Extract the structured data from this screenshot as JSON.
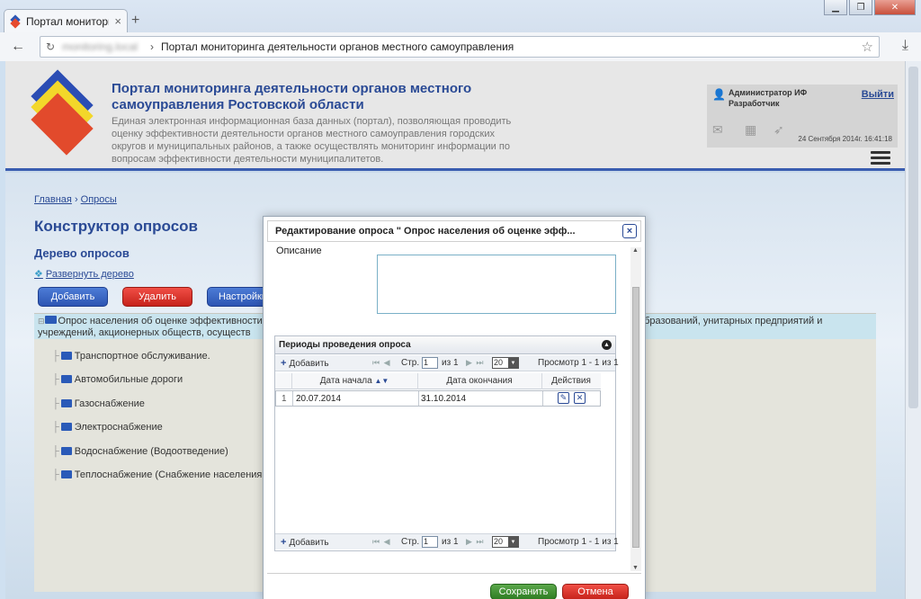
{
  "browser": {
    "tab_title": "Портал мониторинга",
    "tab_close": "×",
    "new_tab": "+",
    "url_host": "monitoring.local",
    "url_separator": "›",
    "page_title": "Портал мониторинга деятельности органов местного самоуправления"
  },
  "header": {
    "title": "Портал мониторинга деятельности органов местного самоуправления Ростовской области",
    "description": "Единая электронная информационная база данных (портал), позволяющая проводить оценку эффективности деятельности органов местного самоуправления городских округов и муниципальных районов, а также осуществлять мониторинг информации по вопросам эффективности деятельности муниципалитетов.",
    "user_name": "Администратор ИФ",
    "user_role": "Разработчик",
    "logout": "Выйти",
    "datetime": "24 Сентября 2014г. 16:41:18"
  },
  "breadcrumb": {
    "home": "Главная",
    "sep": "›",
    "current": "Опросы"
  },
  "main": {
    "title": "Конструктор опросов",
    "tree_title": "Дерево опросов",
    "expand_tree": "Развернуть дерево",
    "buttons": {
      "add": "Добавить",
      "delete": "Удалить",
      "settings": "Настройки"
    },
    "tree_root": "Опрос населения об оценке эффективности",
    "tree_root_line2": "учреждений, акционерных обществ, осуществ",
    "tree_root_tail": "образований, унитарных предприятий и",
    "tree_items": [
      "Транспортное обслуживание.",
      "Автомобильные дороги",
      "Газоснабжение",
      "Электроснабжение",
      "Водоснабжение (Водоотведение)",
      "Теплоснабжение (Снабжение населения"
    ]
  },
  "modal": {
    "title": "Редактирование опроса \" Опрос населения об оценке эфф...",
    "close": "×",
    "description_label": "Описание",
    "description_value": "",
    "grid": {
      "caption": "Периоды проведения опроса",
      "pager": {
        "add_label": "Добавить",
        "page_label": "Стр.",
        "page_value": "1",
        "of_label": "из 1",
        "page_size": "20",
        "view_label": "Просмотр 1 - 1 из 1"
      },
      "columns": [
        "Дата начала",
        "Дата окончания",
        "Действия"
      ],
      "rows": [
        {
          "num": "1",
          "start": "20.07.2014",
          "end": "31.10.2014"
        }
      ]
    },
    "save_label": "Сохранить",
    "cancel_label": "Отмена"
  }
}
